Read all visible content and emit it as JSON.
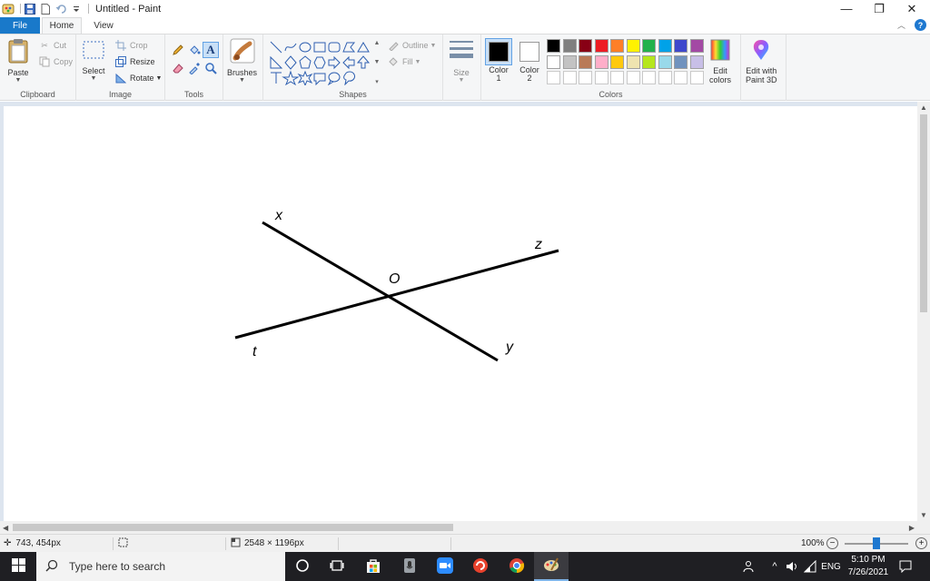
{
  "window": {
    "title": "Untitled - Paint",
    "controls": {
      "minimize": "—",
      "restore": "❐",
      "close": "✕"
    }
  },
  "ribbon": {
    "tabs": {
      "file": "File",
      "home": "Home",
      "view": "View"
    },
    "help_icon": "?",
    "clipboard": {
      "label": "Clipboard",
      "paste": "Paste",
      "cut": "Cut",
      "copy": "Copy"
    },
    "image": {
      "label": "Image",
      "select": "Select",
      "crop": "Crop",
      "resize": "Resize",
      "rotate": "Rotate"
    },
    "tools": {
      "label": "Tools",
      "selected_tool": "text"
    },
    "brushes": {
      "label": "Brushes"
    },
    "shapes": {
      "label": "Shapes",
      "outline": "Outline",
      "fill": "Fill"
    },
    "size": {
      "label": "Size"
    },
    "colors": {
      "label": "Colors",
      "color1_label": "Color",
      "color1_num": "1",
      "color2_label": "Color",
      "color2_num": "2",
      "color1_value": "#000000",
      "color2_value": "#ffffff",
      "edit_colors_line1": "Edit",
      "edit_colors_line2": "colors",
      "palette_row1": [
        "#000000",
        "#7f7f7f",
        "#880015",
        "#ed1c24",
        "#ff7f27",
        "#fff200",
        "#22b14c",
        "#00a2e8",
        "#3f48cc",
        "#a349a4"
      ],
      "palette_row2": [
        "#ffffff",
        "#c3c3c3",
        "#b97a57",
        "#ffaec9",
        "#ffc90e",
        "#efe4b0",
        "#b5e61d",
        "#99d9ea",
        "#7092be",
        "#c8bfe7"
      ],
      "palette_row3": [
        "#ffffff",
        "#ffffff",
        "#ffffff",
        "#ffffff",
        "#ffffff",
        "#ffffff",
        "#ffffff",
        "#ffffff",
        "#ffffff",
        "#ffffff"
      ]
    },
    "paint3d": {
      "line1": "Edit with",
      "line2": "Paint 3D"
    }
  },
  "canvas": {
    "labels": {
      "x": "x",
      "z": "z",
      "o": "O",
      "t": "t",
      "y": "y"
    }
  },
  "status": {
    "cursor_pos": "743, 454px",
    "canvas_size": "2548 × 1196px",
    "zoom": "100%"
  },
  "taskbar": {
    "search_placeholder": "Type here to search",
    "language": "ENG",
    "time": "5:10 PM",
    "date": "7/26/2021"
  }
}
